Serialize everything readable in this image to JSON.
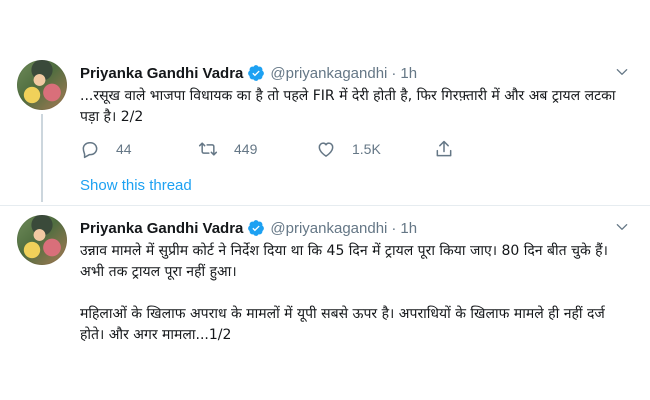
{
  "colors": {
    "accent": "#1da1f2",
    "muted": "#657786",
    "text": "#14171a",
    "divider": "#e6ecf0"
  },
  "tweets": [
    {
      "author": {
        "name": "Priyanka Gandhi Vadra",
        "handle": "@priyankagandhi",
        "verified": true
      },
      "separator": "·",
      "time": "1h",
      "paragraphs": [
        "...रसूख वाले भाजपा विधायक का है तो पहले FIR में देरी होती है, फिर गिरफ़्तारी में और अब ट्रायल लटका पड़ा है। 2/2"
      ],
      "actions": {
        "reply_count": "44",
        "retweet_count": "449",
        "like_count": "1.5K"
      },
      "thread_link": "Show this thread",
      "icons": [
        "chevron-down-icon",
        "reply-icon",
        "retweet-icon",
        "like-icon",
        "share-icon",
        "verified-icon"
      ]
    },
    {
      "author": {
        "name": "Priyanka Gandhi Vadra",
        "handle": "@priyankagandhi",
        "verified": true
      },
      "separator": "·",
      "time": "1h",
      "paragraphs": [
        "उन्नाव मामले में सुप्रीम कोर्ट ने निर्देश दिया था कि 45 दिन में ट्रायल पूरा किया जाए। 80 दिन बीत चुके हैं। अभी तक ट्रायल पूरा नहीं हुआ।",
        "महिलाओं के खिलाफ अपराध के मामलों में यूपी सबसे ऊपर है। अपराधियों के खिलाफ मामले ही नहीं दर्ज होते। और अगर मामला...1/2"
      ]
    }
  ]
}
